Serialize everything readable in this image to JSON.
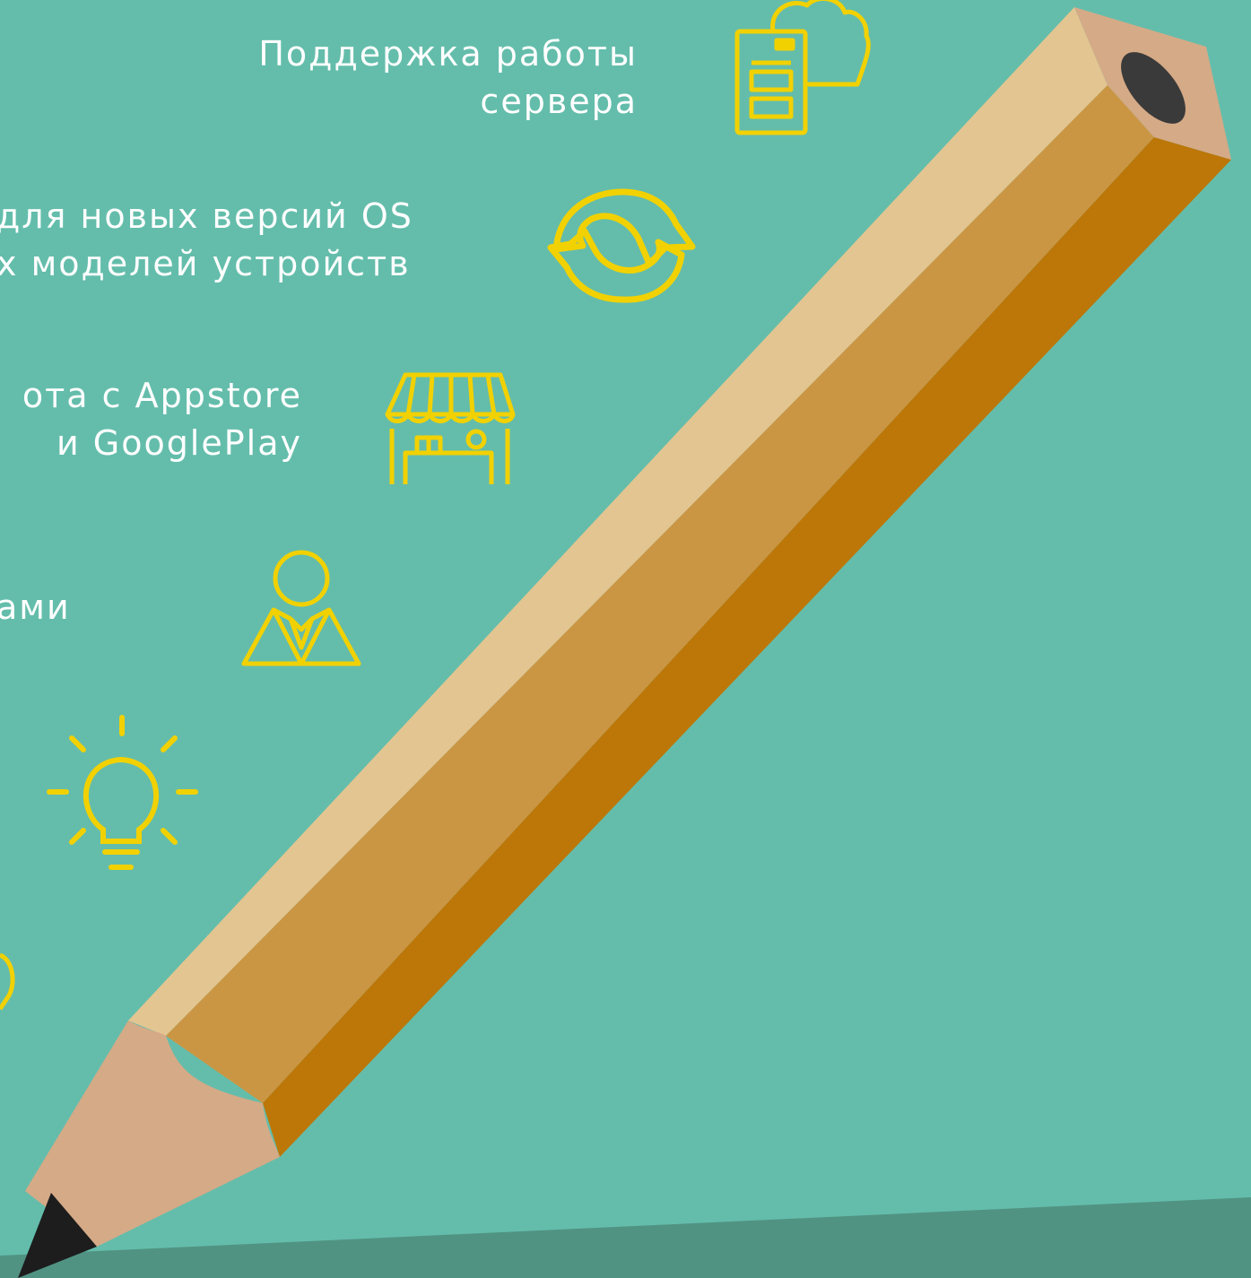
{
  "features": [
    {
      "lines": [
        "Поддержка работы",
        "сервера"
      ],
      "icon": "server-cloud-icon"
    },
    {
      "lines": [
        "для новых версий OS",
        "х моделей устройств"
      ],
      "icon": "refresh-icon"
    },
    {
      "lines": [
        "ота  с Appstore",
        "и GooglePlay"
      ],
      "icon": "store-icon"
    },
    {
      "lines": [
        "ами"
      ],
      "icon": "manager-icon"
    },
    {
      "lines": [],
      "icon": "lightbulb-icon"
    }
  ],
  "colors": {
    "background": "#64bdab",
    "floor": "#519383",
    "icon": "#f2d100",
    "pencil_light": "#e3c591",
    "pencil_mid": "#cb9643",
    "pencil_dark": "#bc7708",
    "wood": "#d5aa87",
    "lead": "#1d1d1d"
  }
}
